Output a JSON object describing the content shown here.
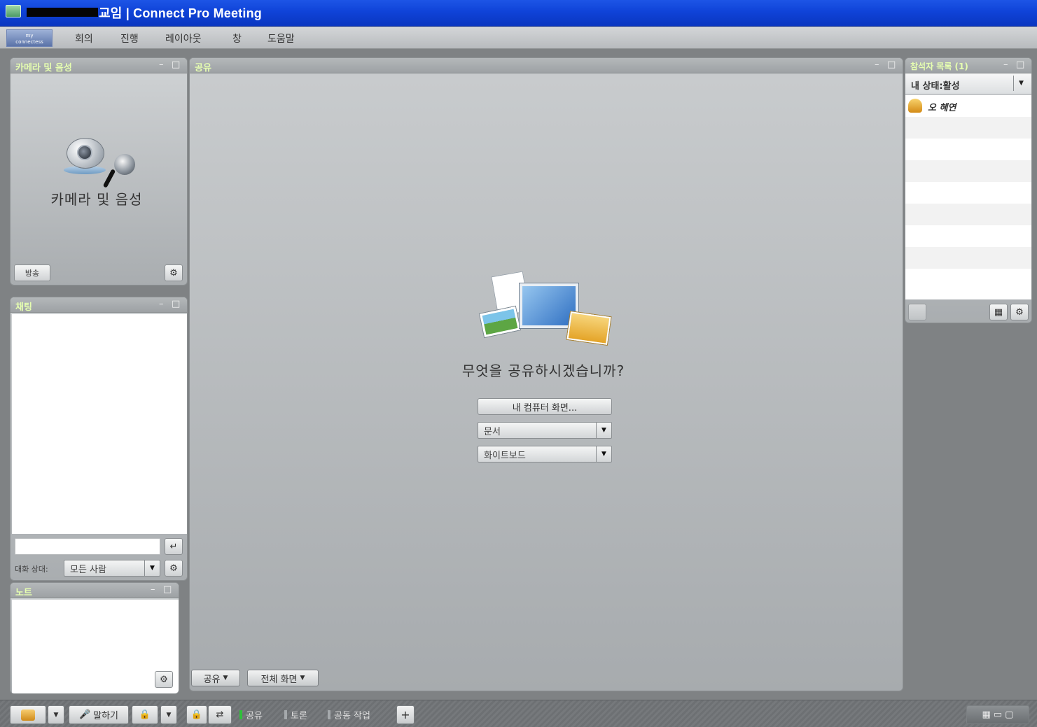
{
  "window": {
    "title": "교임 | Connect Pro Meeting"
  },
  "logo": {
    "line1": "my",
    "line2": "connectess"
  },
  "menu": [
    "회의",
    "진행",
    "레이아웃",
    "창",
    "도움말"
  ],
  "pods": {
    "camera": {
      "title": "카메라 및 음성",
      "center_label": "카메라 및 음성",
      "broadcast_button": "방송"
    },
    "chat": {
      "title": "채팅",
      "message_to_label": "대화 상대:",
      "recipient": "모든 사람"
    },
    "notes": {
      "title": "노트"
    },
    "share": {
      "title": "공유",
      "prompt": "무엇을 공유하시겠습니까?",
      "my_screen_button": "내 컴퓨터 화면...",
      "document_select": "문서",
      "whiteboard_select": "화이트보드",
      "share_menu": "공유",
      "fullscreen_menu": "전체 화면"
    },
    "attendees": {
      "title": "참석자 목록 (1)",
      "my_status": "내 상태:활성",
      "users": [
        "오 혜연"
      ]
    }
  },
  "bottom": {
    "talk_button": "말하기",
    "tabs": [
      {
        "label": "공유",
        "active": true
      },
      {
        "label": "토론",
        "active": false
      },
      {
        "label": "공동 작업",
        "active": false
      }
    ],
    "add_tab": "+"
  },
  "icons": {
    "settings": "gear-icon",
    "enter": "enter-icon",
    "dropdown": "chevron-down-icon"
  },
  "colors": {
    "titlebar": "#0f43d8",
    "pod_title": "#e6ffb0",
    "active_tab": "#2fbf3a"
  }
}
